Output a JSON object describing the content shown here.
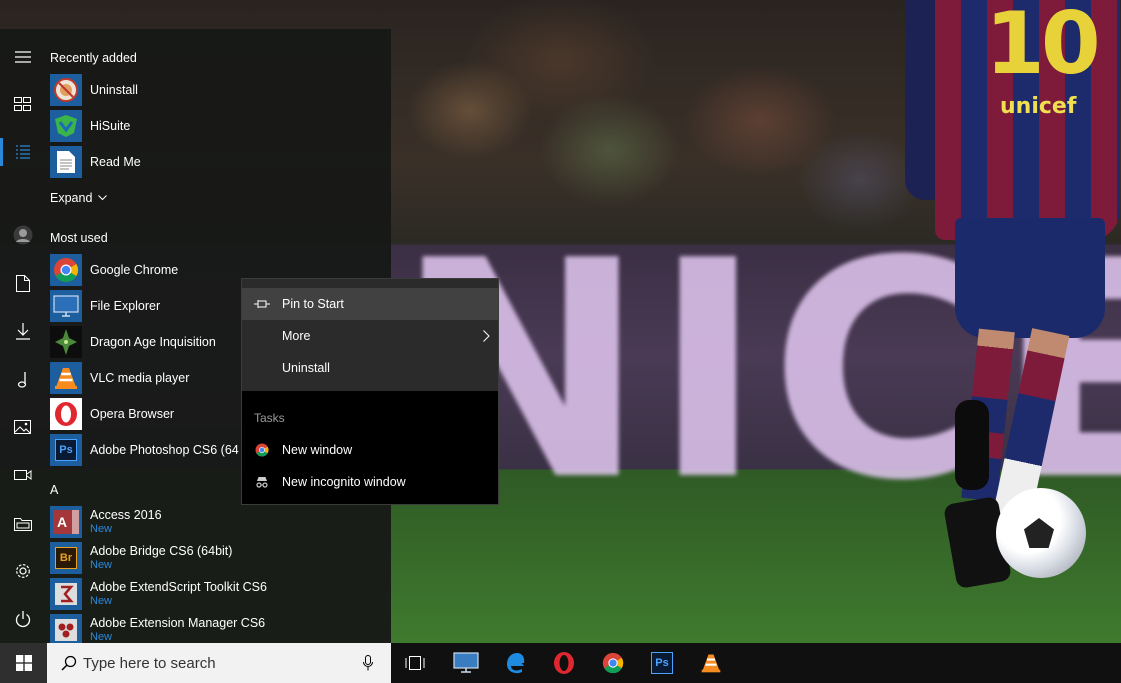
{
  "start_menu": {
    "recently_added_header": "Recently added",
    "recently_added": [
      {
        "label": "Uninstall",
        "icon": "uninstall-icon"
      },
      {
        "label": "HiSuite",
        "icon": "hisuite-icon"
      },
      {
        "label": "Read Me",
        "icon": "document-icon"
      }
    ],
    "expand_label": "Expand",
    "most_used_header": "Most used",
    "most_used": [
      {
        "label": "Google Chrome",
        "icon": "chrome-icon"
      },
      {
        "label": "File Explorer",
        "icon": "monitor-icon"
      },
      {
        "label": "Dragon Age Inquisition",
        "icon": "dragon-age-icon"
      },
      {
        "label": "VLC media player",
        "icon": "vlc-icon"
      },
      {
        "label": "Opera Browser",
        "icon": "opera-icon"
      },
      {
        "label": "Adobe Photoshop CS6 (64 B",
        "icon": "photoshop-icon",
        "tile_text": "Ps"
      }
    ],
    "letter_header": "A",
    "a_apps": [
      {
        "label": "Access 2016",
        "badge": "New",
        "icon": "access-icon",
        "tile_text": "A"
      },
      {
        "label": "Adobe Bridge CS6 (64bit)",
        "badge": "New",
        "icon": "bridge-icon",
        "tile_text": "Br"
      },
      {
        "label": "Adobe ExtendScript Toolkit CS6",
        "badge": "New",
        "icon": "extendscript-icon"
      },
      {
        "label": "Adobe Extension Manager CS6",
        "badge": "New",
        "icon": "extension-manager-icon"
      }
    ]
  },
  "context_menu": {
    "pin_to_start": "Pin to Start",
    "more": "More",
    "uninstall": "Uninstall",
    "tasks_header": "Tasks",
    "new_window": "New window",
    "new_incognito_window": "New incognito window"
  },
  "taskbar": {
    "search_placeholder": "Type here to search",
    "pinned": [
      "task-view-icon",
      "monitor-icon",
      "edge-icon",
      "opera-icon",
      "chrome-icon",
      "photoshop-icon",
      "vlc-icon"
    ],
    "photoshop_tile_text": "Ps"
  },
  "wallpaper": {
    "banner_text": "NICEF",
    "jersey_number": "10",
    "jersey_sponsor": "unicef"
  },
  "colors": {
    "accent": "#2b88d8",
    "menu_background": "#161816",
    "context_menu_top": "#2b2b2b",
    "context_menu_hover": "#414141",
    "taskbar": "#101010"
  }
}
